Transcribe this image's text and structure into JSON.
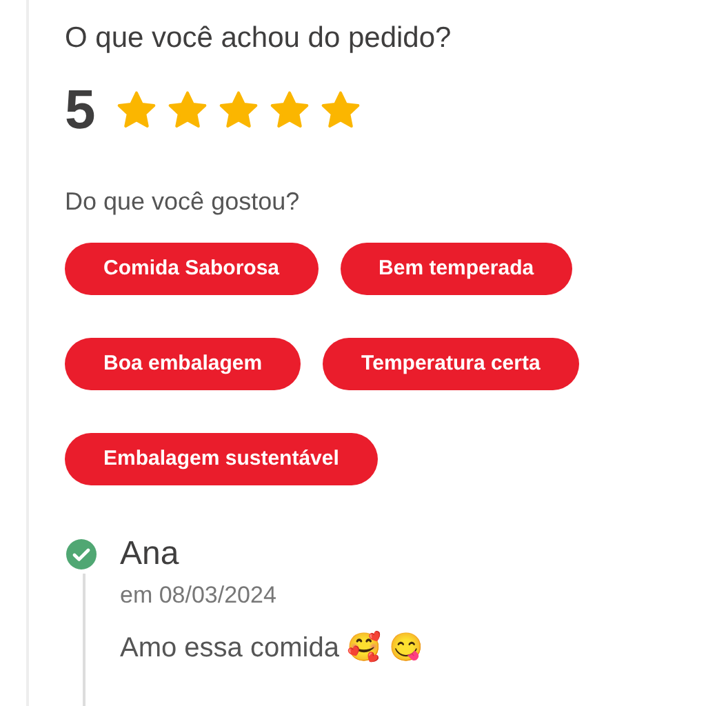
{
  "question": "O que você achou do pedido?",
  "rating": {
    "score": "5",
    "stars": 5
  },
  "likes": {
    "title": "Do que você gostou?",
    "tags": [
      {
        "label": "Comida Saborosa"
      },
      {
        "label": "Bem temperada"
      },
      {
        "label": "Boa embalagem"
      },
      {
        "label": "Temperatura certa"
      },
      {
        "label": "Embalagem sustentável"
      }
    ]
  },
  "comment": {
    "author": "Ana",
    "verified": true,
    "date": "em 08/03/2024",
    "text": "Amo essa comida 🥰 😋"
  }
}
